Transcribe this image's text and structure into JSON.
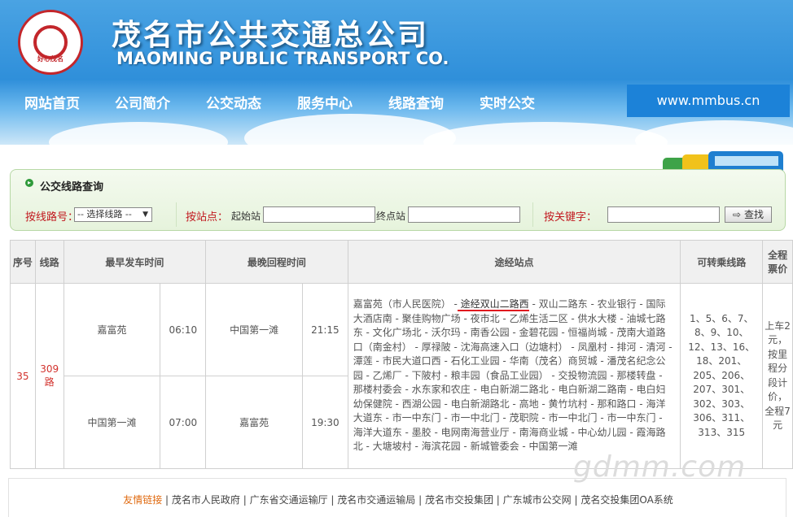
{
  "header": {
    "logo_text": "好心茂名",
    "logo_ring_text": "HAOXINMAOMING",
    "title_cn": "茂名市公共交通总公司",
    "title_en": "MAOMING PUBLIC TRANSPORT CO.",
    "site_url": "www.mmbus.cn",
    "nav": [
      "网站首页",
      "公司简介",
      "公交动态",
      "服务中心",
      "线路查询",
      "实时公交"
    ]
  },
  "query": {
    "title": "公交线路查询",
    "by_line_label": "按线路号：",
    "line_select_value": "-- 选择线路 --",
    "by_stop_label": "按站点：",
    "start_label": "起始站",
    "end_label": "终点站",
    "by_keyword_label": "按关键字：",
    "search_button": "查找"
  },
  "table": {
    "headers": {
      "index": "序号",
      "line": "线路",
      "earliest": "最早发车时间",
      "latest": "最晚回程时间",
      "stops": "途经站点",
      "transfer": "可转乘线路",
      "fare": "全程票价"
    },
    "row": {
      "index": "35",
      "line": "309路",
      "earliest": [
        {
          "station": "嘉富苑",
          "time": "06:10"
        },
        {
          "station": "中国第一滩",
          "time": "07:00"
        }
      ],
      "latest": [
        {
          "station": "中国第一滩",
          "time": "21:15"
        },
        {
          "station": "嘉富苑",
          "time": "19:30"
        }
      ],
      "stops_before": "嘉富苑（市人民医院） -",
      "stops_highlight": " 途经双山二路西",
      "stops_after": " - 双山二路东 - 农业银行 - 国际大酒店南 - 聚佳购物广场 - 夜市北 - 乙烯生活二区 - 供水大楼 - 油城七路东 - 文化广场北 - 沃尔玛 - 南香公园 - 金碧花园 - 恒福尚城 - 茂南大道路口（南金村） - 厚禄陂 - 沈海高速入口（边塘村） - 凤凰村 - 排河 - 清河 - 潭莲 - 市民大道口西 - 石化工业园 - 华南（茂名）商贸城 - 潘茂名纪念公园 - 乙烯厂 - 下陂村 - 粮丰园（食品工业园） - 交投物流园 - 那楼转盘 - 那楼村委会 - 水东家和农庄 - 电白新湖二路北 - 电白新湖二路南 - 电白妇幼保健院 - 西湖公园 - 电白新湖路北 - 高地 - 黄竹坑村 - 那和路口 - 海洋大道东 - 市一中东门 - 市一中北门 - 茂职院 - 市一中北门 - 市一中东门 - 海洋大道东 - 墨胶 - 电网南海营业厅 - 南海商业城 - 中心幼儿园 - 霞海路北 - 大塘坡村 - 海滨花园 - 新城管委会 - 中国第一滩",
      "transfer": "1、5、6、7、8、9、10、12、13、16、18、201、205、206、207、301、302、303、306、311、313、315",
      "fare": "上车2元，按里程分段计价，全程7元"
    }
  },
  "footer": {
    "links": [
      "友情链接",
      "茂名市人民政府",
      "广东省交通运输厅",
      "茂名市交通运输局",
      "茂名市交投集团",
      "广东城市公交网",
      "茂名交投集团OA系统"
    ]
  },
  "watermark": "gdmm.com",
  "colors": {
    "accent_red": "#d2322d",
    "header_blue": "#2f8fda",
    "panel_green": "#e6f3dc"
  }
}
